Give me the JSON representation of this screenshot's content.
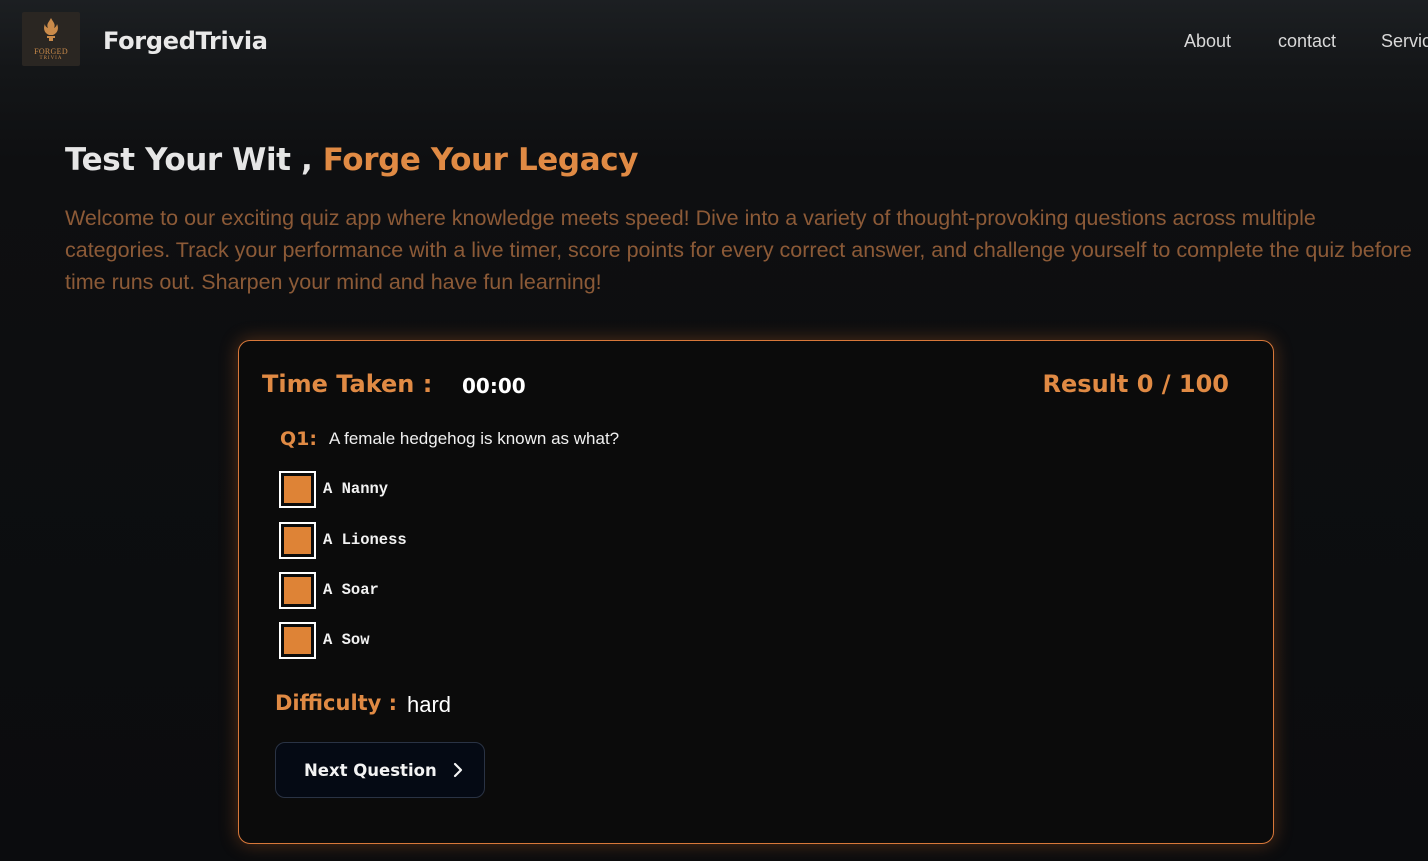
{
  "header": {
    "logo_text": "FORGED",
    "logo_subtext": "TRIVIA",
    "brand": "ForgedTrivia",
    "nav": [
      {
        "label": "About"
      },
      {
        "label": "contact"
      },
      {
        "label": "Servic"
      }
    ]
  },
  "hero": {
    "title_part1": "Test Your Wit ,",
    "title_part2": "Forge Your Legacy",
    "description": "Welcome to our exciting quiz app where knowledge meets speed! Dive into a variety of thought-provoking questions across multiple categories. Track your performance with a live timer, score points for every correct answer, and challenge yourself to complete the quiz before time runs out. Sharpen your mind and have fun learning!"
  },
  "quiz": {
    "time_label": "Time Taken :",
    "time_value": "00:00",
    "result_label": "Result 0 / 100",
    "question_number": "Q1:",
    "question_text": "A female hedgehog is known as what?",
    "options": [
      {
        "label": "A Nanny"
      },
      {
        "label": "A Lioness"
      },
      {
        "label": "A Soar"
      },
      {
        "label": "A Sow"
      }
    ],
    "difficulty_label": "Difficulty :",
    "difficulty_value": "hard",
    "next_button": "Next Question"
  },
  "colors": {
    "accent": "#e08a44",
    "checkbox_fill": "#de8336",
    "card_border": "#d8783a",
    "description_text": "#8c5a37",
    "button_bg": "#050a14"
  }
}
